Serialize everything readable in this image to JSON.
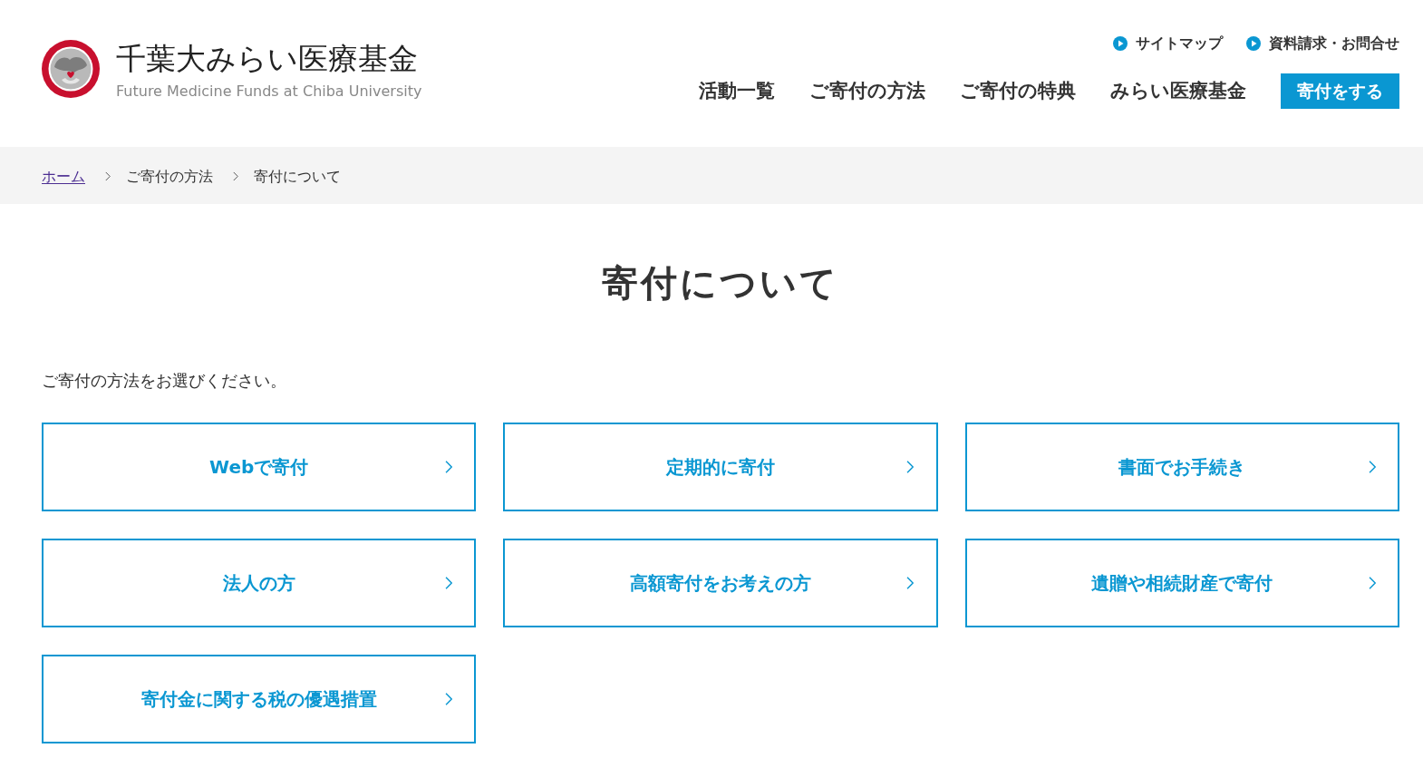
{
  "header": {
    "logo": {
      "title": "千葉大みらい医療基金",
      "subtitle": "Future Medicine Funds at Chiba University"
    },
    "utility_links": [
      "サイトマップ",
      "資料請求・お問合せ"
    ],
    "nav": [
      "活動一覧",
      "ご寄付の方法",
      "ご寄付の特典",
      "みらい医療基金"
    ],
    "donate_button": "寄付をする"
  },
  "breadcrumb": [
    {
      "label": "ホーム",
      "link": true
    },
    {
      "label": "ご寄付の方法",
      "link": false
    },
    {
      "label": "寄付について",
      "link": false
    }
  ],
  "page_title": "寄付について",
  "intro": "ご寄付の方法をお選びください。",
  "options": [
    "Webで寄付",
    "定期的に寄付",
    "書面でお手続き",
    "法人の方",
    "高額寄付をお考えの方",
    "遺贈や相続財産で寄付",
    "寄付金に関する税の優遇措置"
  ]
}
